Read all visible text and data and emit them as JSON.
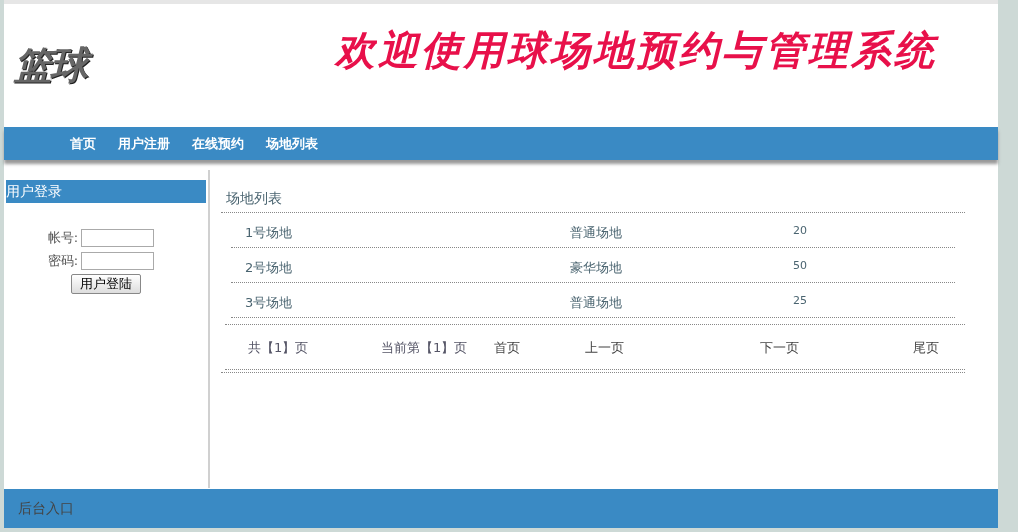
{
  "header": {
    "logo": "篮球",
    "banner": "欢迎使用球场地预约与管理系统"
  },
  "nav": [
    {
      "label": "首页"
    },
    {
      "label": "用户注册"
    },
    {
      "label": "在线预约"
    },
    {
      "label": "场地列表"
    }
  ],
  "login": {
    "title": "用户登录",
    "fields": [
      {
        "label": "帐号:"
      },
      {
        "label": "密码:"
      }
    ],
    "button": "用户登陆"
  },
  "venues": {
    "title": "场地列表",
    "rows": [
      {
        "name": "1号场地",
        "type": "普通场地",
        "price": "20"
      },
      {
        "name": "2号场地",
        "type": "豪华场地",
        "price": "50"
      },
      {
        "name": "3号场地",
        "type": "普通场地",
        "price": "25"
      }
    ],
    "pager": {
      "total": "共【1】页",
      "current": "当前第【1】页",
      "links": [
        "首页",
        "上一页",
        "下一页",
        "尾页"
      ]
    }
  },
  "footer": "后台入口"
}
